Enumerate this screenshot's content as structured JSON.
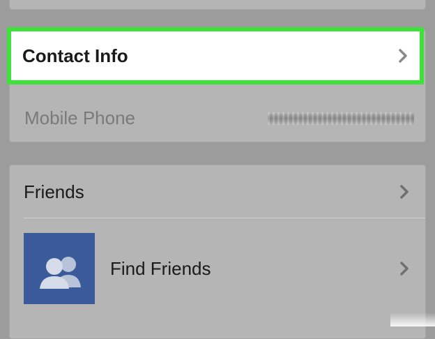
{
  "contact_section": {
    "contact_info_label": "Contact Info",
    "mobile_phone_label": "Mobile Phone",
    "highlight_color": "#3ee33a"
  },
  "friends_section": {
    "friends_label": "Friends",
    "find_friends_label": "Find Friends"
  },
  "icons": {
    "chevron": "chevron-right-icon",
    "find_friends": "friends-silhouette-icon"
  },
  "colors": {
    "background": "#9c9c9c",
    "card": "#b5b5b5",
    "facebook_blue": "#3a5a99"
  }
}
